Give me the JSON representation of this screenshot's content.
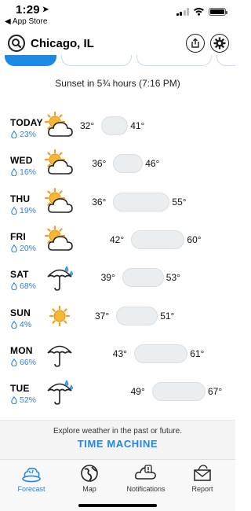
{
  "status_bar": {
    "time": "1:29",
    "location_arrow": "➤",
    "back_label": "◀ App Store"
  },
  "header": {
    "location": "Chicago, IL",
    "icons": [
      "search-icon",
      "share-icon",
      "gear-icon"
    ]
  },
  "tabs": [],
  "sunset_text": "Sunset in 5¾ hours (7:16 PM)",
  "forecast": [
    {
      "day": "TODAY",
      "precip": "23%",
      "icon": "partly-cloudy-icon",
      "low": "32°",
      "high": "41°",
      "low_value": 32,
      "high_value": 41
    },
    {
      "day": "WED",
      "precip": "16%",
      "icon": "partly-cloudy-icon",
      "low": "36°",
      "high": "46°",
      "low_value": 36,
      "high_value": 46
    },
    {
      "day": "THU",
      "precip": "19%",
      "icon": "partly-cloudy-icon",
      "low": "36°",
      "high": "55°",
      "low_value": 36,
      "high_value": 55
    },
    {
      "day": "FRI",
      "precip": "20%",
      "icon": "partly-cloudy-icon",
      "low": "42°",
      "high": "60°",
      "low_value": 42,
      "high_value": 60
    },
    {
      "day": "SAT",
      "precip": "68%",
      "icon": "rain-umbrella-icon",
      "low": "39°",
      "high": "53°",
      "low_value": 39,
      "high_value": 53
    },
    {
      "day": "SUN",
      "precip": "4%",
      "icon": "sun-icon",
      "low": "37°",
      "high": "51°",
      "low_value": 37,
      "high_value": 51
    },
    {
      "day": "MON",
      "precip": "66%",
      "icon": "umbrella-icon",
      "low": "43°",
      "high": "61°",
      "low_value": 43,
      "high_value": 61
    },
    {
      "day": "TUE",
      "precip": "52%",
      "icon": "rain-umbrella-icon",
      "low": "49°",
      "high": "67°",
      "low_value": 49,
      "high_value": 67
    }
  ],
  "time_machine": {
    "subtitle": "Explore weather in the past or future.",
    "title": "TIME MACHINE"
  },
  "bottom_nav": [
    {
      "label": "Forecast",
      "icon": "forecast-icon",
      "active": true
    },
    {
      "label": "Map",
      "icon": "globe-icon",
      "active": false
    },
    {
      "label": "Notifications",
      "icon": "notification-cloud-icon",
      "active": false
    },
    {
      "label": "Report",
      "icon": "report-envelope-icon",
      "active": false
    }
  ],
  "colors": {
    "accent": "#1e88e5",
    "precip": "#2f7fd1",
    "sun": "#f5a623",
    "bar": "#ebeef1"
  }
}
